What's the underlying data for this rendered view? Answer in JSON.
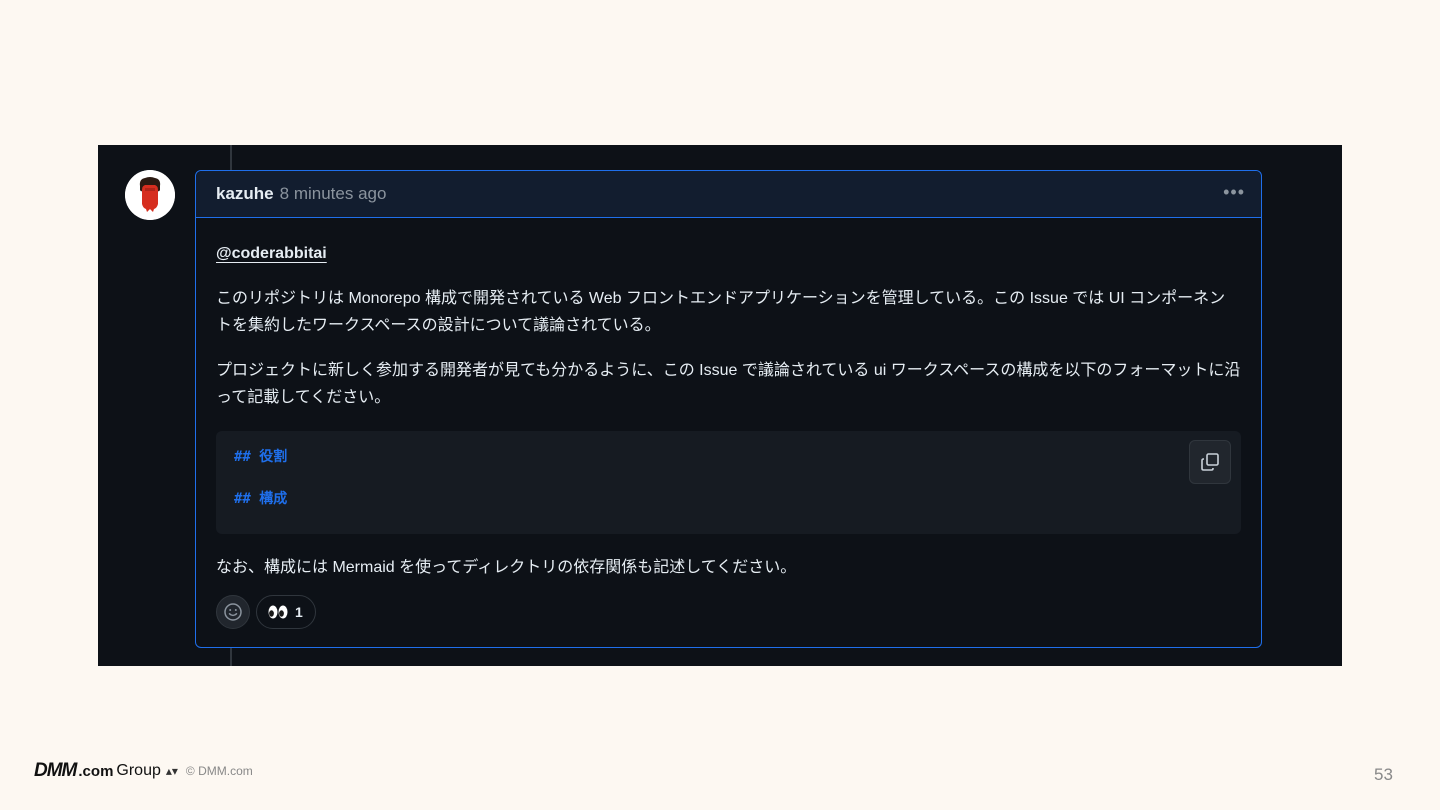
{
  "comment": {
    "author": "kazuhe",
    "timestamp": "8 minutes ago",
    "menu_icon": "kebab-horizontal-icon",
    "mention": "@coderabbitai",
    "paragraphs": [
      "このリポジトリは Monorepo 構成で開発されている Web フロントエンドアプリケーションを管理している。この Issue では UI コンポーネントを集約したワークスペースの設計について議論されている。",
      "プロジェクトに新しく参加する開発者が見ても分かるように、この Issue で議論されている ui ワークスペースの構成を以下のフォーマットに沿って記載してください。"
    ],
    "code_lines": [
      "## 役割",
      "## 構成"
    ],
    "closing": "なお、構成には Mermaid を使ってディレクトリの依存関係も記述してください。",
    "reactions": [
      {
        "icon": "eyes-icon",
        "emoji": "👀",
        "count": "1"
      }
    ]
  },
  "footer": {
    "logo_dmm": "DMM",
    "logo_com": ".com",
    "logo_group": "Group",
    "copyright": "© DMM.com",
    "page_number": "53"
  },
  "colors": {
    "background": "#fdf8f2",
    "screen_bg": "#0d1117",
    "accent": "#1f6feb",
    "text": "#e6edf3",
    "muted": "#8b949e"
  }
}
